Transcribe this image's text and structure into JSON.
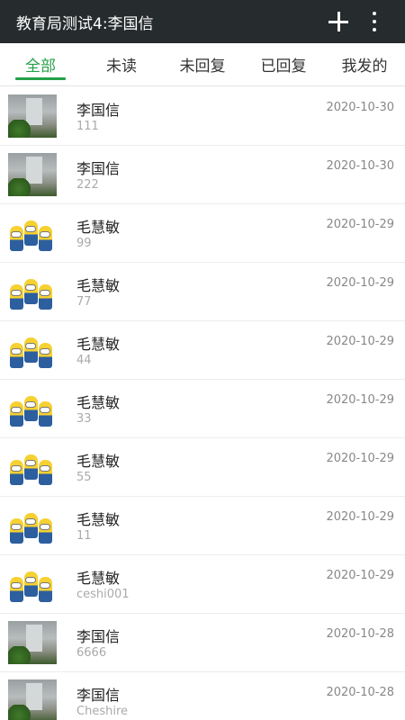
{
  "appbar": {
    "title": "教育局测试4:李国信",
    "icons": [
      "plus-icon",
      "more-vert-icon"
    ]
  },
  "tabs": [
    {
      "label": "全部",
      "active": true
    },
    {
      "label": "未读",
      "active": false
    },
    {
      "label": "未回复",
      "active": false
    },
    {
      "label": "已回复",
      "active": false
    },
    {
      "label": "我发的",
      "active": false
    }
  ],
  "accent_color": "#25a04a",
  "messages": [
    {
      "name": "李国信",
      "preview": "111",
      "date": "2020-10-30",
      "avatar": "office"
    },
    {
      "name": "李国信",
      "preview": "222",
      "date": "2020-10-30",
      "avatar": "office"
    },
    {
      "name": "毛慧敏",
      "preview": "99",
      "date": "2020-10-29",
      "avatar": "minion"
    },
    {
      "name": "毛慧敏",
      "preview": "77",
      "date": "2020-10-29",
      "avatar": "minion"
    },
    {
      "name": "毛慧敏",
      "preview": "44",
      "date": "2020-10-29",
      "avatar": "minion"
    },
    {
      "name": "毛慧敏",
      "preview": "33",
      "date": "2020-10-29",
      "avatar": "minion"
    },
    {
      "name": "毛慧敏",
      "preview": "55",
      "date": "2020-10-29",
      "avatar": "minion"
    },
    {
      "name": "毛慧敏",
      "preview": "11",
      "date": "2020-10-29",
      "avatar": "minion"
    },
    {
      "name": "毛慧敏",
      "preview": "ceshi001",
      "date": "2020-10-29",
      "avatar": "minion"
    },
    {
      "name": "李国信",
      "preview": "6666",
      "date": "2020-10-28",
      "avatar": "office"
    },
    {
      "name": "李国信",
      "preview": "Cheshire",
      "date": "2020-10-28",
      "avatar": "office"
    }
  ]
}
